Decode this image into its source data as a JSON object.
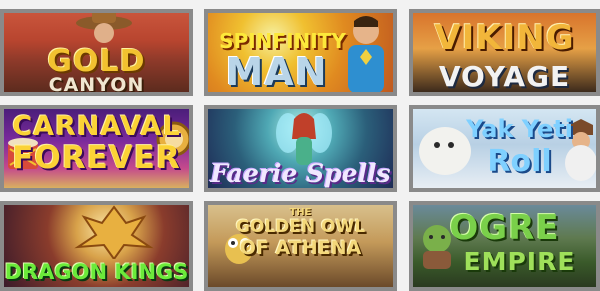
{
  "games": [
    {
      "id": "gold-canyon",
      "logo_line1": "GOLD",
      "logo_line2": "CANYON"
    },
    {
      "id": "spinfinity-man",
      "logo_line1": "SPINFINITY",
      "logo_line2": "MAN"
    },
    {
      "id": "viking-voyage",
      "logo_line1": "VIKING",
      "logo_line2": "VOYAGE"
    },
    {
      "id": "carnaval-forever",
      "logo_line1": "CARNAVAL",
      "logo_line2": "FOREVER"
    },
    {
      "id": "faerie-spells",
      "logo_line1": "Faerie Spells"
    },
    {
      "id": "yak-yeti-roll",
      "logo_line1": "Yak Yeti",
      "logo_line2": "Roll"
    },
    {
      "id": "dragon-kings",
      "logo_line1": "DRAGON KINGS"
    },
    {
      "id": "golden-owl-athena",
      "logo_line0": "THE",
      "logo_line1": "GOLDEN OWL",
      "logo_line2": "OF ATHENA"
    },
    {
      "id": "ogre-empire",
      "logo_line1": "OGRE",
      "logo_line2": "EMPIRE"
    }
  ],
  "colors": {
    "page_background": "#f2f2f2",
    "tile_border": "#8a8a8a"
  }
}
